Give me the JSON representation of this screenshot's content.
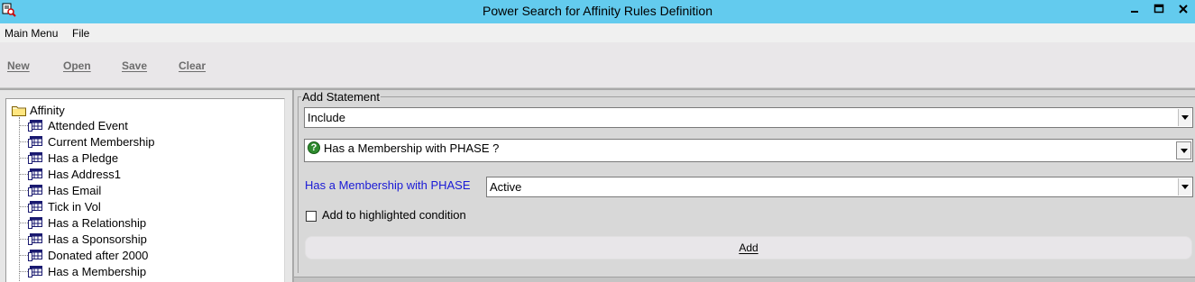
{
  "window": {
    "title": "Power Search for Affinity Rules Definition",
    "controls": [
      "minimize-icon",
      "maximize-icon",
      "close-icon"
    ]
  },
  "menu": {
    "items": [
      "Main Menu",
      "File"
    ]
  },
  "toolbar": {
    "new_label": "New",
    "open_label": "Open",
    "save_label": "Save",
    "clear_label": "Clear"
  },
  "tree": {
    "root_label": "Affinity",
    "root_icon": "folder-icon",
    "item_icon": "table-icon",
    "items": [
      "Attended Event",
      "Current Membership",
      "Has a Pledge",
      "Has Address1",
      "Has Email",
      "Tick in Vol",
      "Has a Relationship",
      "Has a Sponsorship",
      "Donated after 2000",
      "Has a Membership"
    ]
  },
  "statement": {
    "group_label": "Add Statement",
    "include_value": "Include",
    "condition_value": "Has a Membership with PHASE ?",
    "condition_icon": "question-icon",
    "phase_label": "Has a Membership with PHASE",
    "phase_value": "Active",
    "highlight_checkbox_label": "Add to highlighted condition",
    "highlight_checked": false,
    "add_button_label": "Add"
  },
  "colors": {
    "titlebar": "#63cbee",
    "field_label": "#1a1ad6",
    "question_icon": "#2e8b2e"
  }
}
